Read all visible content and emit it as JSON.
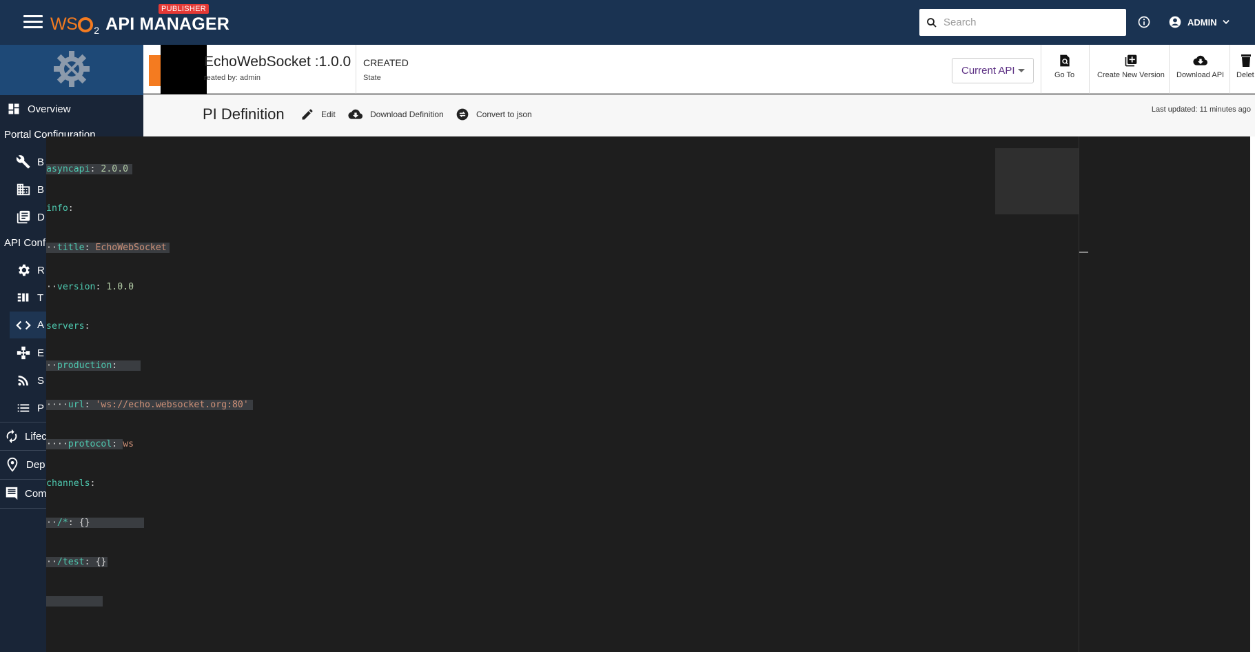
{
  "topbar": {
    "logo_prefix": "WS",
    "logo_sub": "2",
    "logo_text": "API MANAGER",
    "badge": "PUBLISHER",
    "search_placeholder": "Search",
    "user_name": "ADMIN",
    "bg_color": "#1a3352"
  },
  "sidebar": {
    "overview": "Overview",
    "portal_config": "Portal Configuration",
    "portal_items": [
      "B",
      "B",
      "D"
    ],
    "api_config": "API Confi",
    "api_items": [
      "R",
      "T",
      "A",
      "E",
      "S",
      "P"
    ],
    "lifecycle": "Lifec",
    "deployments": "Dep",
    "comments": "Com"
  },
  "api": {
    "title": "EchoWebSocket :1.0.0",
    "created_by": "reated by: admin",
    "state_value": "CREATED",
    "state_label": "State",
    "current_api": "Current API",
    "actions": {
      "go_to": "Go To",
      "create_new_version": "Create New Version",
      "download_api": "Download API",
      "delete": "Delet"
    }
  },
  "definition": {
    "title": "PI Definition",
    "edit": "Edit",
    "download": "Download Definition",
    "convert": "Convert to json",
    "last_updated": "Last updated: 11 minutes ago"
  },
  "code_lines": [
    [
      "asyncapi",
      "2.0.0"
    ],
    [
      "info",
      ""
    ],
    [
      "title",
      "EchoWebSocket"
    ],
    [
      "version",
      "1.0.0"
    ],
    [
      "servers",
      ""
    ],
    [
      "production",
      ""
    ],
    [
      "url",
      "'ws://echo.websocket.org:80'"
    ],
    [
      "protocol",
      "ws"
    ],
    [
      "channels",
      ""
    ],
    [
      "/*",
      "{}"
    ],
    [
      "/test",
      "{}"
    ]
  ]
}
